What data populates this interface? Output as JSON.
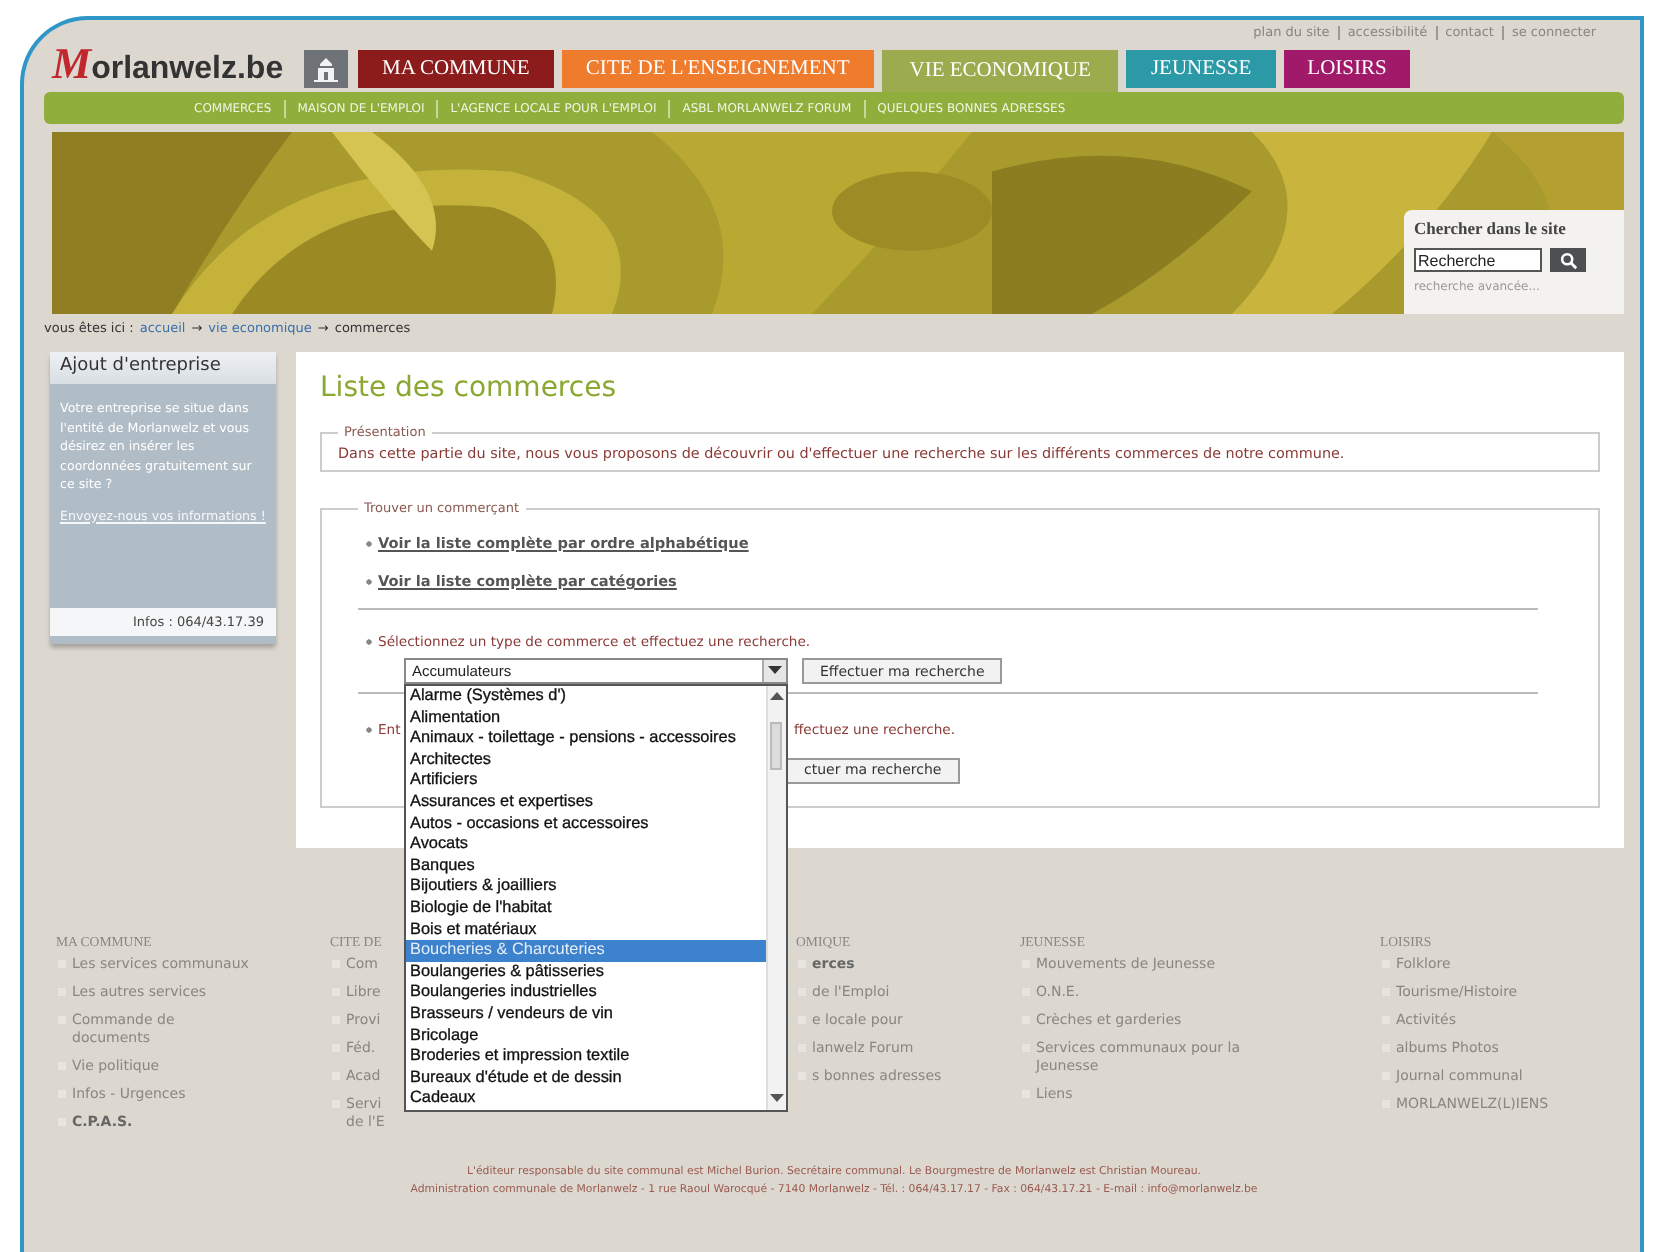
{
  "top_links": [
    "plan du site",
    "accessibilité",
    "contact",
    "se connecter"
  ],
  "logo": "Morlanwelz.be",
  "tabs": [
    {
      "label": "MA COMMUNE",
      "color": "#8c1c1c",
      "selected": false
    },
    {
      "label": "CITE DE L'ENSEIGNEMENT",
      "color": "#ef7b2c",
      "selected": false
    },
    {
      "label": "VIE ECONOMIQUE",
      "color": "#9bab4e",
      "selected": true
    },
    {
      "label": "JEUNESSE",
      "color": "#2b9aa6",
      "selected": false
    },
    {
      "label": "LOISIRS",
      "color": "#a11a6a",
      "selected": false
    }
  ],
  "subnav": [
    "COMMERCES",
    "MAISON DE L'EMPLOI",
    "L'AGENCE LOCALE POUR L'EMPLOI",
    "ASBL MORLANWELZ FORUM",
    "QUELQUES BONNES ADRESSES"
  ],
  "banner": {
    "kind": "picture"
  },
  "search": {
    "title": "Chercher dans le site",
    "value": "Recherche",
    "advanced": "recherche avancée..."
  },
  "breadcrumb": {
    "label": "vous êtes ici :",
    "items": [
      {
        "kind": "link",
        "text": "accueil"
      },
      {
        "kind": "sep",
        "text": "→"
      },
      {
        "kind": "link",
        "text": "vie economique"
      },
      {
        "kind": "sep",
        "text": "→"
      },
      {
        "kind": "current",
        "text": "commerces"
      }
    ]
  },
  "sidebar": {
    "title": "Ajout d'entreprise",
    "text": "Votre entreprise se situe dans l'entité de Morlanwelz et vous désirez en insérer les coordonnées gratuitement sur ce site ?",
    "link": "Envoyez-nous vos informations !",
    "info": "Infos : 064/43.17.39"
  },
  "main": {
    "title": "Liste des commerces",
    "presentation": {
      "legend": "Présentation",
      "text": "Dans cette partie du site, nous vous proposons de découvrir ou d'effectuer une recherche sur les différents commerces de notre commune."
    },
    "finder": {
      "legend": "Trouver un commerçant",
      "links": [
        "Voir la liste complète par ordre alphabétique",
        "Voir la liste complète par catégories"
      ],
      "select_prompt": "Sélectionnez un type de commerce et effectuez une recherche.",
      "select": {
        "value": "Accumulateurs",
        "expanded": true,
        "options": [
          {
            "label": "Alarme (Systèmes d')",
            "selected": false
          },
          {
            "label": "Alimentation",
            "selected": false
          },
          {
            "label": "Animaux - toilettage - pensions - accessoires",
            "selected": false
          },
          {
            "label": "Architectes",
            "selected": false
          },
          {
            "label": "Artificiers",
            "selected": false
          },
          {
            "label": "Assurances et expertises",
            "selected": false
          },
          {
            "label": "Autos - occasions et accessoires",
            "selected": false
          },
          {
            "label": "Avocats",
            "selected": false
          },
          {
            "label": "Banques",
            "selected": false
          },
          {
            "label": "Bijoutiers & joailliers",
            "selected": false
          },
          {
            "label": "Biologie de l'habitat",
            "selected": false
          },
          {
            "label": "Bois et matériaux",
            "selected": false
          },
          {
            "label": "Boucheries & Charcuteries",
            "selected": true
          },
          {
            "label": "Boulangeries & pâtisseries",
            "selected": false
          },
          {
            "label": "Boulangeries industrielles",
            "selected": false
          },
          {
            "label": "Brasseurs / vendeurs de vin",
            "selected": false
          },
          {
            "label": "Bricolage",
            "selected": false
          },
          {
            "label": "Broderies et impression textile",
            "selected": false
          },
          {
            "label": "Bureaux d'étude et de dessin",
            "selected": false
          },
          {
            "label": "Cadeaux",
            "selected": false
          }
        ]
      },
      "button": "Effectuer ma recherche",
      "second_prompt_start": "Ent",
      "second_prompt_end": "ffectuez une recherche.",
      "second_button": "ctuer ma recherche"
    }
  },
  "footer": {
    "columns": [
      {
        "title": "MA COMMUNE",
        "items": [
          {
            "label": "Les services communaux",
            "bold": false
          },
          {
            "label": "Les autres services",
            "bold": false
          },
          {
            "label": "Commande de documents",
            "bold": false
          },
          {
            "label": "Vie politique",
            "bold": false
          },
          {
            "label": "Infos - Urgences",
            "bold": false
          },
          {
            "label": "C.P.A.S.",
            "bold": true
          }
        ]
      },
      {
        "title": "CITE DE",
        "items": [
          {
            "label": "Com",
            "bold": false
          },
          {
            "label": "Libre",
            "bold": false
          },
          {
            "label": "Provi",
            "bold": false
          },
          {
            "label": "Féd.",
            "bold": false
          },
          {
            "label": "Acad",
            "bold": false
          },
          {
            "label": "Servi de l'E",
            "bold": false
          }
        ]
      },
      {
        "title": "OMIQUE",
        "items": [
          {
            "label": "erces",
            "bold": true
          },
          {
            "label": "de l'Emploi",
            "bold": false
          },
          {
            "label": "e locale pour",
            "bold": false
          },
          {
            "label": "lanwelz Forum",
            "bold": false
          },
          {
            "label": "s bonnes adresses",
            "bold": false
          }
        ]
      },
      {
        "title": "JEUNESSE",
        "items": [
          {
            "label": "Mouvements de Jeunesse",
            "bold": false
          },
          {
            "label": "O.N.E.",
            "bold": false
          },
          {
            "label": "Crèches et garderies",
            "bold": false
          },
          {
            "label": "Services communaux pour la Jeunesse",
            "bold": false
          },
          {
            "label": "Liens",
            "bold": false
          }
        ]
      },
      {
        "title": "LOISIRS",
        "items": [
          {
            "label": "Folklore",
            "bold": false
          },
          {
            "label": "Tourisme/Histoire",
            "bold": false
          },
          {
            "label": "Activités",
            "bold": false
          },
          {
            "label": "albums Photos",
            "bold": false
          },
          {
            "label": "Journal communal",
            "bold": false
          },
          {
            "label": "MORLANWELZ(L)IENS",
            "bold": false
          }
        ]
      }
    ]
  },
  "credits": [
    "L'éditeur responsable du site communal est Michel Burion. Secrétaire communal. Le Bourgmestre de Morlanwelz est Christian Moureau.",
    "Administration communale de Morlanwelz - 1 rue Raoul Warocqué - 7140 Morlanwelz - Tél. : 064/43.17.17 - Fax : 064/43.17.21 - E-mail : info@morlanwelz.be"
  ]
}
